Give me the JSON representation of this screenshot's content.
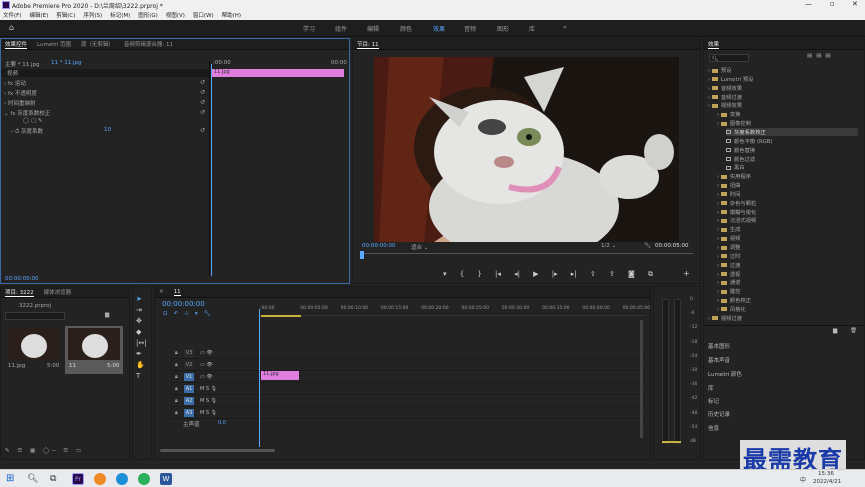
{
  "window": {
    "title": "Adobe Premiere Pro 2020 - D:\\兰周绍\\3222.prproj *"
  },
  "menu": [
    "文件(F)",
    "编辑(E)",
    "剪辑(C)",
    "序列(S)",
    "标记(M)",
    "图形(G)",
    "视图(V)",
    "窗口(W)",
    "帮助(H)"
  ],
  "workspaces": [
    "学习",
    "组件",
    "编辑",
    "颜色",
    "效果",
    "音频",
    "图形",
    "库"
  ],
  "effect_controls": {
    "tabs": [
      "效果控件",
      "Lumetri 范围",
      "源（无剪辑）",
      "音频剪辑混合器: 11"
    ],
    "master": "主要 * 11.jpg",
    "seq": "11 * 11.jpg",
    "tc_start": ":00:00",
    "tc_end": "00:00",
    "section": "视频",
    "rows": [
      "运动",
      "不透明度",
      "时间重映射",
      "灰度系数校正",
      "灰度系数"
    ],
    "gamma_value": "10",
    "clip": "11.jpg",
    "tc_bottom": "00:00:00:00"
  },
  "program": {
    "tab": "节目: 11",
    "tc_left": "00:00:00:00",
    "fit": "适合",
    "quality": "1/2",
    "tc_right": "00:00:05:00"
  },
  "effects": {
    "tab": "效果",
    "tree": [
      {
        "t": "预设",
        "i": 0,
        "k": "fold"
      },
      {
        "t": "Lumetri 预设",
        "i": 0,
        "k": "fold"
      },
      {
        "t": "音频效果",
        "i": 0,
        "k": "fold"
      },
      {
        "t": "音频过渡",
        "i": 0,
        "k": "fold"
      },
      {
        "t": "视频效果",
        "i": 0,
        "k": "fold"
      },
      {
        "t": "变换",
        "i": 1,
        "k": "fold"
      },
      {
        "t": "图像控制",
        "i": 1,
        "k": "fold"
      },
      {
        "t": "灰度系数校正",
        "i": 2,
        "k": "fx",
        "sel": true
      },
      {
        "t": "颜色平衡 (RGB)",
        "i": 2,
        "k": "fx"
      },
      {
        "t": "颜色替换",
        "i": 2,
        "k": "fx"
      },
      {
        "t": "颜色过滤",
        "i": 2,
        "k": "fx"
      },
      {
        "t": "黑白",
        "i": 2,
        "k": "fx"
      },
      {
        "t": "实用程序",
        "i": 1,
        "k": "fold"
      },
      {
        "t": "扭曲",
        "i": 1,
        "k": "fold"
      },
      {
        "t": "时间",
        "i": 1,
        "k": "fold"
      },
      {
        "t": "杂色与颗粒",
        "i": 1,
        "k": "fold"
      },
      {
        "t": "模糊与锐化",
        "i": 1,
        "k": "fold"
      },
      {
        "t": "沉浸式视频",
        "i": 1,
        "k": "fold"
      },
      {
        "t": "生成",
        "i": 1,
        "k": "fold"
      },
      {
        "t": "视频",
        "i": 1,
        "k": "fold"
      },
      {
        "t": "调整",
        "i": 1,
        "k": "fold"
      },
      {
        "t": "过时",
        "i": 1,
        "k": "fold"
      },
      {
        "t": "过渡",
        "i": 1,
        "k": "fold"
      },
      {
        "t": "透视",
        "i": 1,
        "k": "fold"
      },
      {
        "t": "通道",
        "i": 1,
        "k": "fold"
      },
      {
        "t": "键控",
        "i": 1,
        "k": "fold"
      },
      {
        "t": "颜色校正",
        "i": 1,
        "k": "fold"
      },
      {
        "t": "风格化",
        "i": 1,
        "k": "fold"
      },
      {
        "t": "视频过渡",
        "i": 0,
        "k": "fold"
      }
    ],
    "sections": [
      "基本图形",
      "基本声音",
      "Lumetri 颜色",
      "库",
      "标记",
      "历史记录",
      "信息"
    ]
  },
  "project": {
    "tabs": [
      "项目: 3222",
      "媒体浏览器"
    ],
    "file": "3222.prproj",
    "items": [
      {
        "name": "11.jpg",
        "dur": "5:00"
      },
      {
        "name": "11",
        "dur": "5:00"
      }
    ]
  },
  "timeline": {
    "tab": "11",
    "tc": "00:00:00:00",
    "ruler": [
      ":00:00",
      "00:00:05:00",
      "00:00:10:00",
      "00:00:15:00",
      "00:00:20:00",
      "00:00:25:00",
      "00:00:30:00",
      "00:00:35:00",
      "00:00:40:00",
      "00:00:45:00"
    ],
    "tracks": [
      "V3",
      "V2",
      "V1",
      "A1",
      "A2",
      "A3"
    ],
    "master": "主声道",
    "master_val": "0.0",
    "clip": "11.jpg"
  },
  "meter": {
    "scale": [
      "0",
      "-6",
      "-12",
      "-18",
      "-24",
      "-30",
      "-36",
      "-42",
      "-48",
      "-54",
      "dB"
    ]
  },
  "watermark": "最需教育",
  "taskbar": {
    "time": "15:36",
    "date": "2022/4/21",
    "lang": "中"
  }
}
